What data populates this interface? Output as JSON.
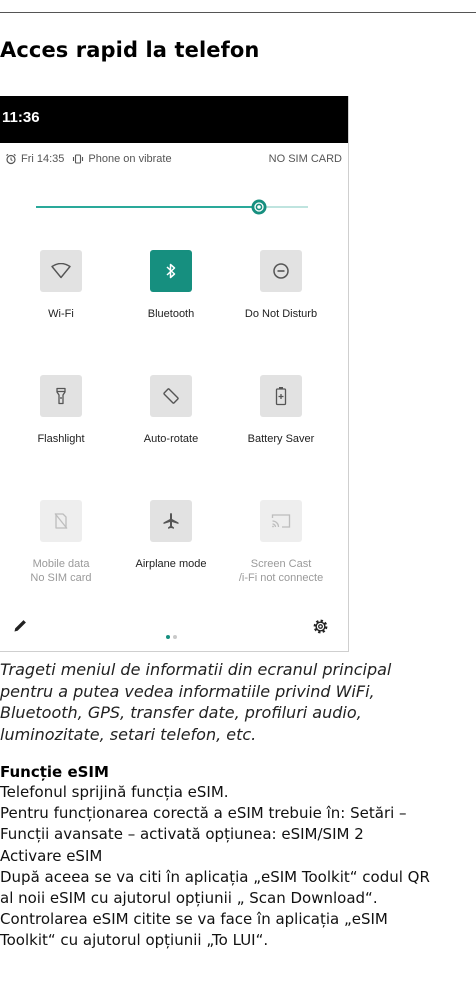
{
  "heading": "Acces rapid la telefon",
  "phone": {
    "status_time": "11:36",
    "alarm": "Fri 14:35",
    "ringer": "Phone on vibrate",
    "sim_status": "NO SIM CARD",
    "brightness_level": 0.82,
    "accent_color": "#168f7f",
    "tiles": [
      {
        "label": "Wi-Fi",
        "icon": "wifi-icon",
        "state": "off"
      },
      {
        "label": "Bluetooth",
        "icon": "bluetooth-icon",
        "state": "on"
      },
      {
        "label": "Do Not Disturb",
        "icon": "do-not-disturb-icon",
        "state": "off"
      },
      {
        "label": "Flashlight",
        "icon": "flashlight-icon",
        "state": "off"
      },
      {
        "label": "Auto-rotate",
        "icon": "auto-rotate-icon",
        "state": "off"
      },
      {
        "label": "Battery Saver",
        "icon": "battery-saver-icon",
        "state": "off"
      },
      {
        "label": "Mobile data",
        "sublabel": "No SIM card",
        "icon": "mobile-data-icon",
        "state": "unavailable"
      },
      {
        "label": "Airplane mode",
        "icon": "airplane-icon",
        "state": "off"
      },
      {
        "label": "Screen Cast",
        "sublabel": "/i-Fi not connecte",
        "icon": "screen-cast-icon",
        "state": "unavailable"
      }
    ],
    "page_indicator": {
      "pages": 2,
      "current": 1
    }
  },
  "caption": [
    "Trageti meniul de informatii din ecranul principal",
    "pentru a putea vedea informatiile privind WiFi,",
    "Bluetooth, GPS, transfer date, profiluri audio,",
    "luminozitate, setari telefon, etc."
  ],
  "esim": {
    "title": "Funcție eSIM",
    "lines": [
      "Telefonul sprijină funcția eSIM.",
      "Pentru funcționarea corectă a eSIM trebuie în: Setări –",
      "Funcții avansate – activată opțiunea: eSIM/SIM 2",
      "Activare eSIM",
      "După aceea se va citi în aplicația „eSIM Toolkit“ codul QR",
      "al noii eSIM cu ajutorul opțiunii „ Scan Download“.",
      "Controlarea eSIM citite se va face în aplicația „eSIM",
      "Toolkit“ cu ajutorul opțiunii „To LUI“."
    ]
  }
}
